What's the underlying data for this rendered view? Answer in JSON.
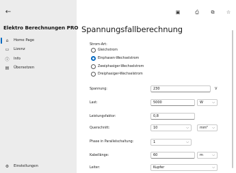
{
  "sidebar": {
    "app_title": "Elektro Berechnungen PRO",
    "back_icon": "←",
    "items": [
      {
        "label": "Home Page",
        "icon": "⌂"
      },
      {
        "label": "Lizenz",
        "icon": "▭"
      },
      {
        "label": "Info",
        "icon": "ⓘ"
      },
      {
        "label": "Übersetzen",
        "icon": "▤"
      }
    ],
    "settings": {
      "label": "Einstellungen",
      "icon": "⚙"
    }
  },
  "toolbar": {
    "icons": [
      "▣",
      "⎙",
      "⧉",
      "☆"
    ]
  },
  "main": {
    "title": "Spannungsfallberechnung",
    "strom_art_label": "Strom-Art:",
    "radio_options": [
      {
        "label": "Gleichstrom",
        "checked": false
      },
      {
        "label": "Einphasen-Wechselstrom",
        "checked": true
      },
      {
        "label": "Zweiphasiger-Wechselstrom",
        "checked": false
      },
      {
        "label": "Dreiphasiger-Wechselstrom",
        "checked": false
      }
    ],
    "fields": {
      "spannung": {
        "label": "Spannung:",
        "value": "230",
        "unit": "V"
      },
      "last": {
        "label": "Last:",
        "value": "5000",
        "unit": "W"
      },
      "leistungsfaktor": {
        "label": "Leistungsfaktor:",
        "value": "0,8"
      },
      "querschnitt": {
        "label": "Querschnitt:",
        "value": "10",
        "unit": "mm²"
      },
      "parallel": {
        "label": "Phase in Parallelschaltung:",
        "value": "1"
      },
      "kabellaenge": {
        "label": "Kabellänge:",
        "value": "60",
        "unit": "m"
      },
      "leiter": {
        "label": "Leiter:",
        "value": "Kupfer"
      }
    },
    "chevron": "⌵"
  },
  "colors": {
    "accent": "#0067c0",
    "sidebar_bg": "#ececec"
  }
}
